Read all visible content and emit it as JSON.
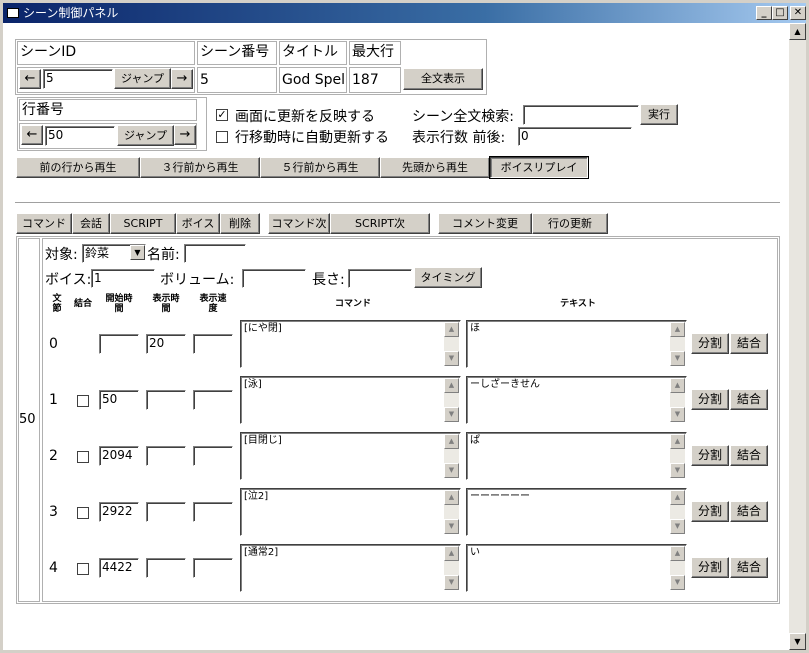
{
  "window": {
    "title": "シーン制御パネル",
    "minimize": "_",
    "maximize": "□",
    "close": "✕"
  },
  "scene_table": {
    "headers": [
      "シーンID",
      "シーン番号",
      "タイトル",
      "最大行"
    ],
    "scene_id_value": "5",
    "jump_label": "ジャンプ",
    "prev_arrow": "←",
    "next_arrow": "→",
    "scene_number": "5",
    "title": "God Spell",
    "max_line": "187",
    "full_text_button": "全文表示"
  },
  "line_box": {
    "header": "行番号",
    "value": "50",
    "jump_label": "ジャンプ",
    "prev_arrow": "←",
    "next_arrow": "→"
  },
  "options": {
    "reflect_label": "画面に更新を反映する",
    "reflect_checked": true,
    "auto_update_label": "行移動時に自動更新する",
    "auto_update_checked": false,
    "search_label": "シーン全文検索:",
    "search_value": "",
    "execute_label": "実行",
    "display_lines_label": "表示行数 前後:",
    "display_lines_value": "0"
  },
  "playback_buttons": [
    "前の行から再生",
    "３行前から再生",
    "５行前から再生",
    "先頭から再生",
    "ボイスリプレイ"
  ],
  "tabs": [
    "コマンド",
    "会話",
    "SCRIPT",
    "ボイス",
    "削除",
    "コマンド次",
    "SCRIPT次",
    "コメント変更",
    "行の更新"
  ],
  "detail": {
    "line_number": "50",
    "target_label": "対象:",
    "target_value": "鈴菜",
    "name_label": "名前:",
    "name_value": "",
    "voice_label": "ボイス:",
    "voice_value": "1",
    "volume_label": "ボリューム:",
    "volume_value": "",
    "length_label": "長さ:",
    "length_value": "",
    "timing_label": "タイミング",
    "headers": {
      "phrase": "文\n節",
      "merge": "結合",
      "start_time": "開始時\n間",
      "display_time": "表示時\n間",
      "display_speed": "表示速\n度",
      "command": "コマンド",
      "text": "テキスト"
    },
    "split_label": "分割",
    "merge_label": "結合",
    "rows": [
      {
        "index": "0",
        "has_checkbox": false,
        "start": "",
        "display": "20",
        "speed": "",
        "command": "[にや閉]",
        "text": "ほ"
      },
      {
        "index": "1",
        "has_checkbox": true,
        "start": "50",
        "display": "",
        "speed": "",
        "command": "[泳]",
        "text": "ーしざーきせん"
      },
      {
        "index": "2",
        "has_checkbox": true,
        "start": "2094",
        "display": "",
        "speed": "",
        "command": "[目閉じ]",
        "text": "ぱ"
      },
      {
        "index": "3",
        "has_checkbox": true,
        "start": "2922",
        "display": "",
        "speed": "",
        "command": "[泣2]",
        "text": "ーーーーーー"
      },
      {
        "index": "4",
        "has_checkbox": true,
        "start": "4422",
        "display": "",
        "speed": "",
        "command": "[通常2]",
        "text": "い"
      }
    ]
  }
}
